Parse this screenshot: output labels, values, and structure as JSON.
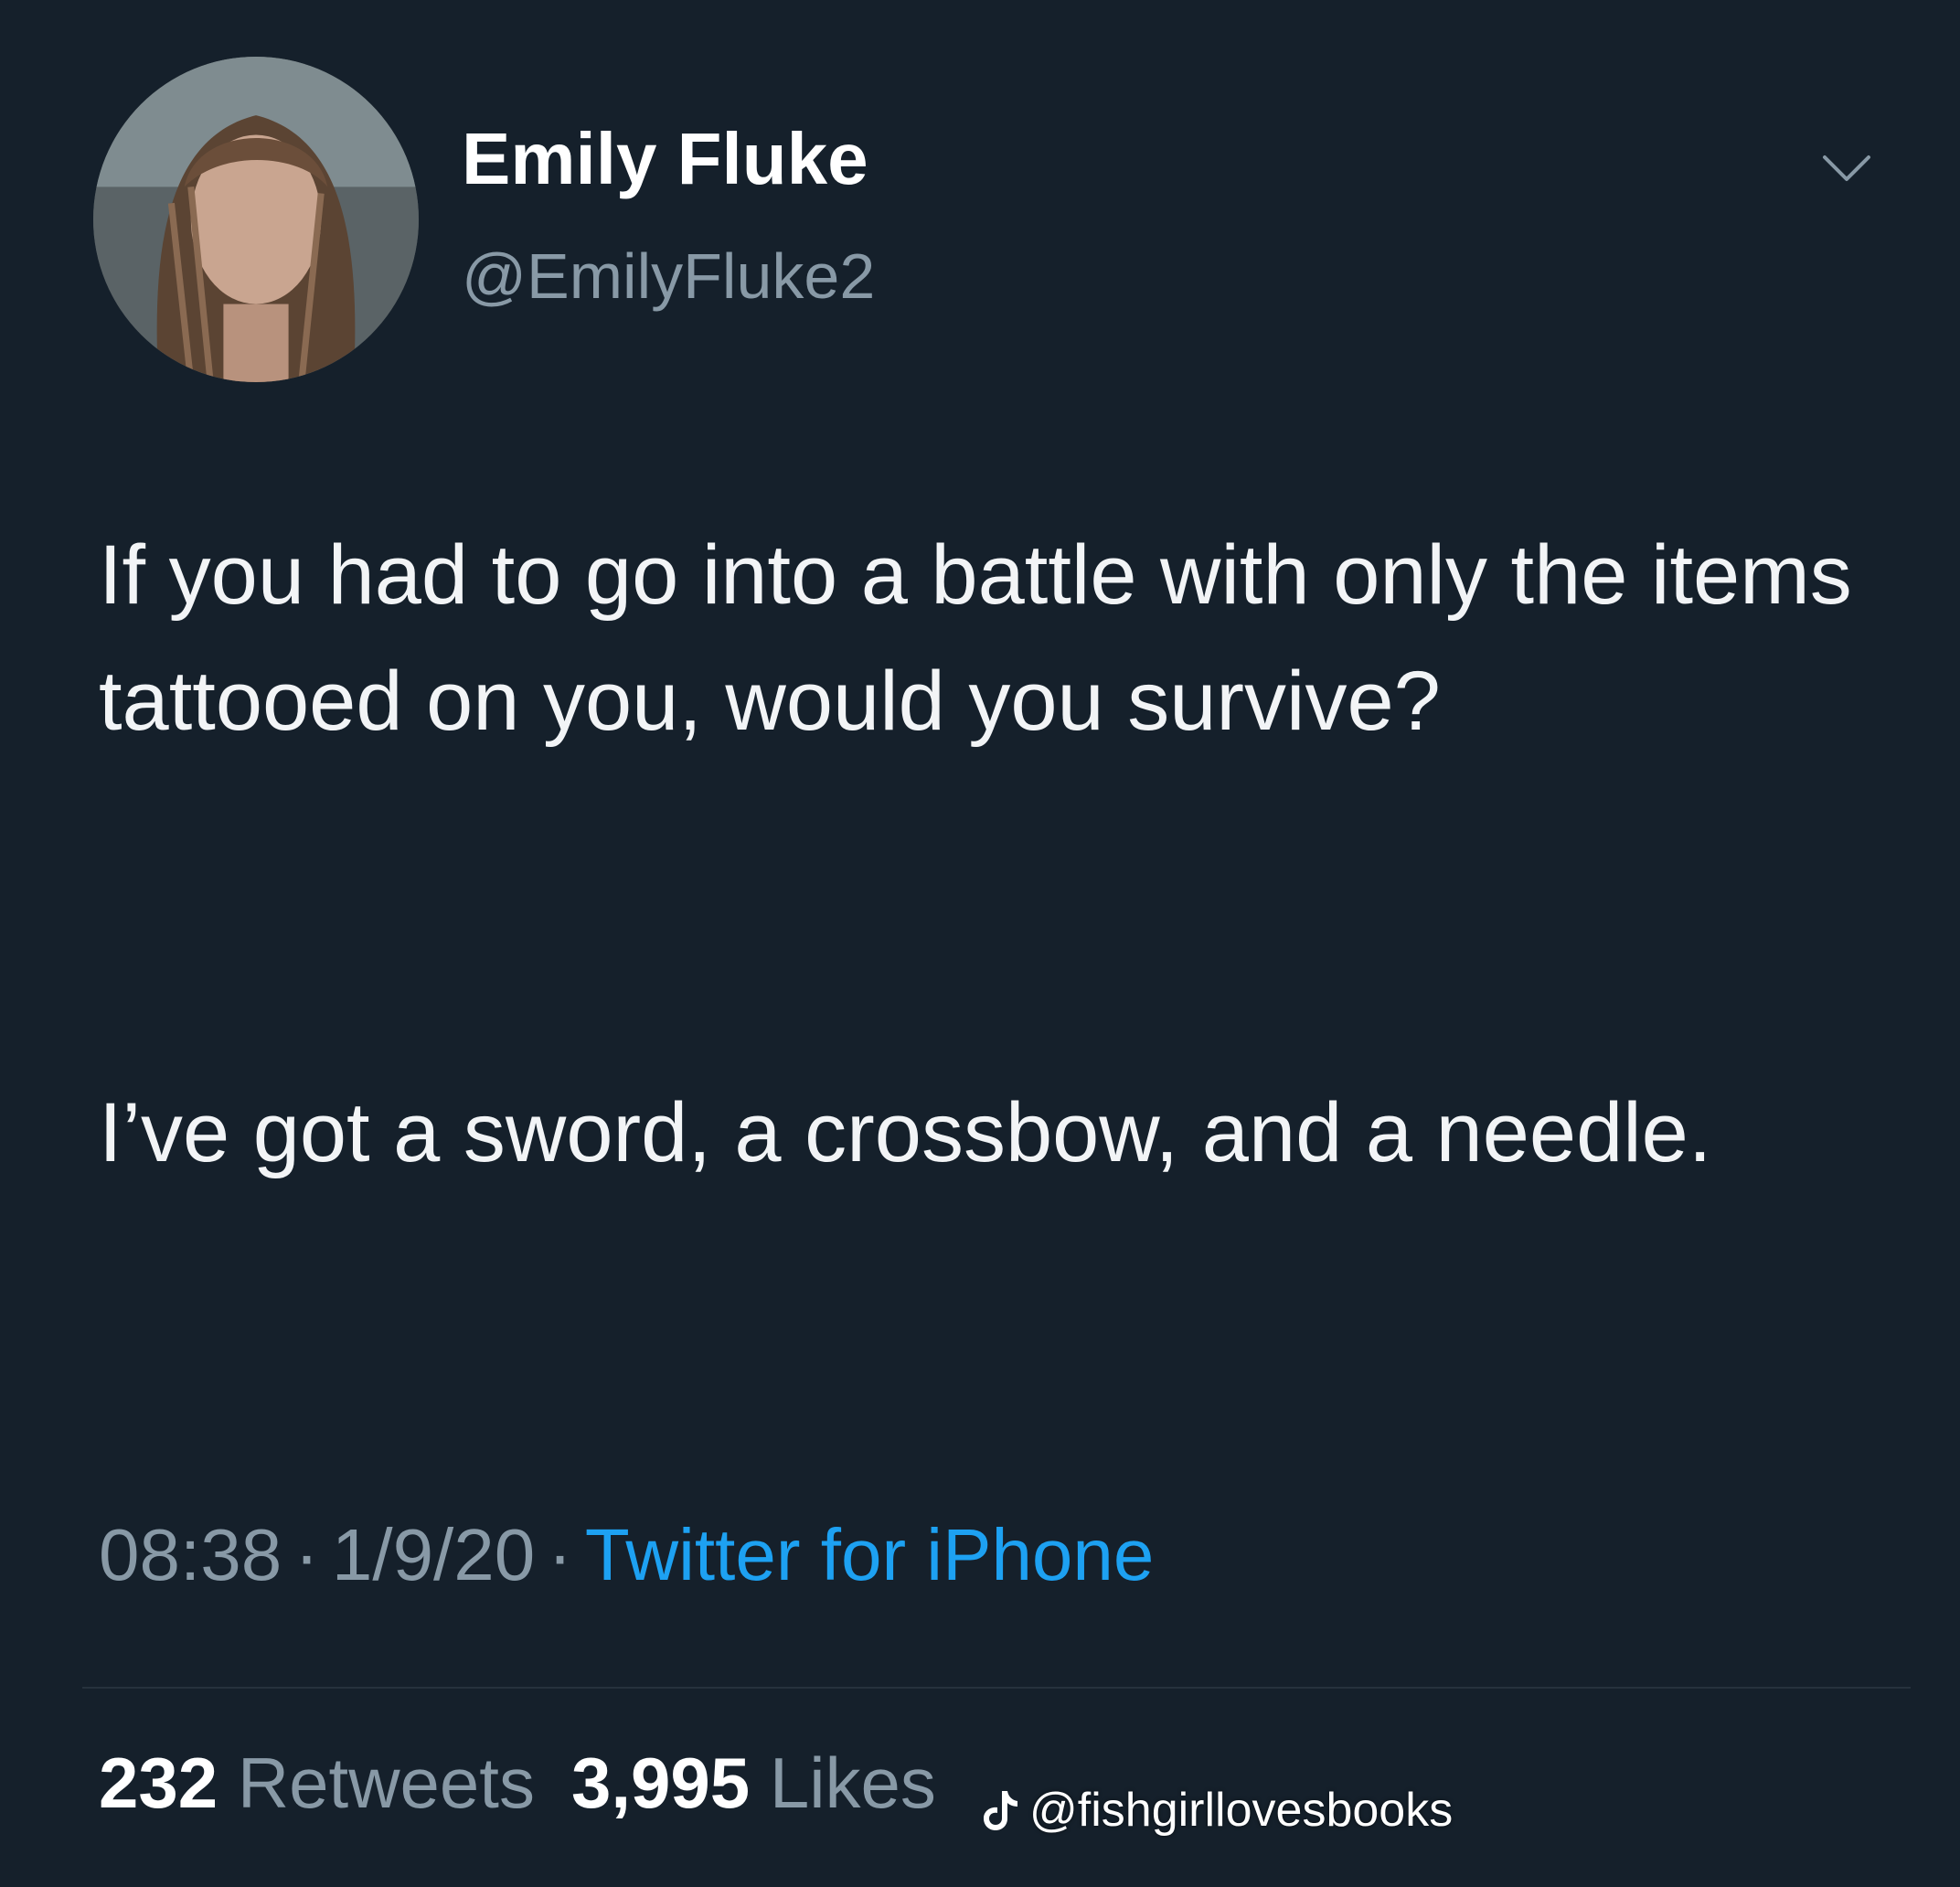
{
  "tweet": {
    "author": {
      "name": "Emily Fluke",
      "handle": "@EmilyFluke2"
    },
    "text_paragraphs": [
      "If you had to go into a battle with only the items tattooed on you, would you survive?",
      "I’ve got a sword, a crossbow, and a needle."
    ],
    "meta": {
      "time": "08:38",
      "separator": "·",
      "date": "1/9/20",
      "source": "Twitter for iPhone"
    },
    "stats": {
      "retweets_count": "232",
      "retweets_label": "Retweets",
      "likes_count": "3,995",
      "likes_label": "Likes"
    }
  },
  "watermark": {
    "text": "@fishgirllovesbooks",
    "icon": "tiktok-icon"
  },
  "icons": {
    "menu": "chevron-down-icon"
  },
  "colors": {
    "background": "#15202b",
    "text": "#f2f4f6",
    "secondary": "#8899a6",
    "link": "#1da1f2"
  }
}
